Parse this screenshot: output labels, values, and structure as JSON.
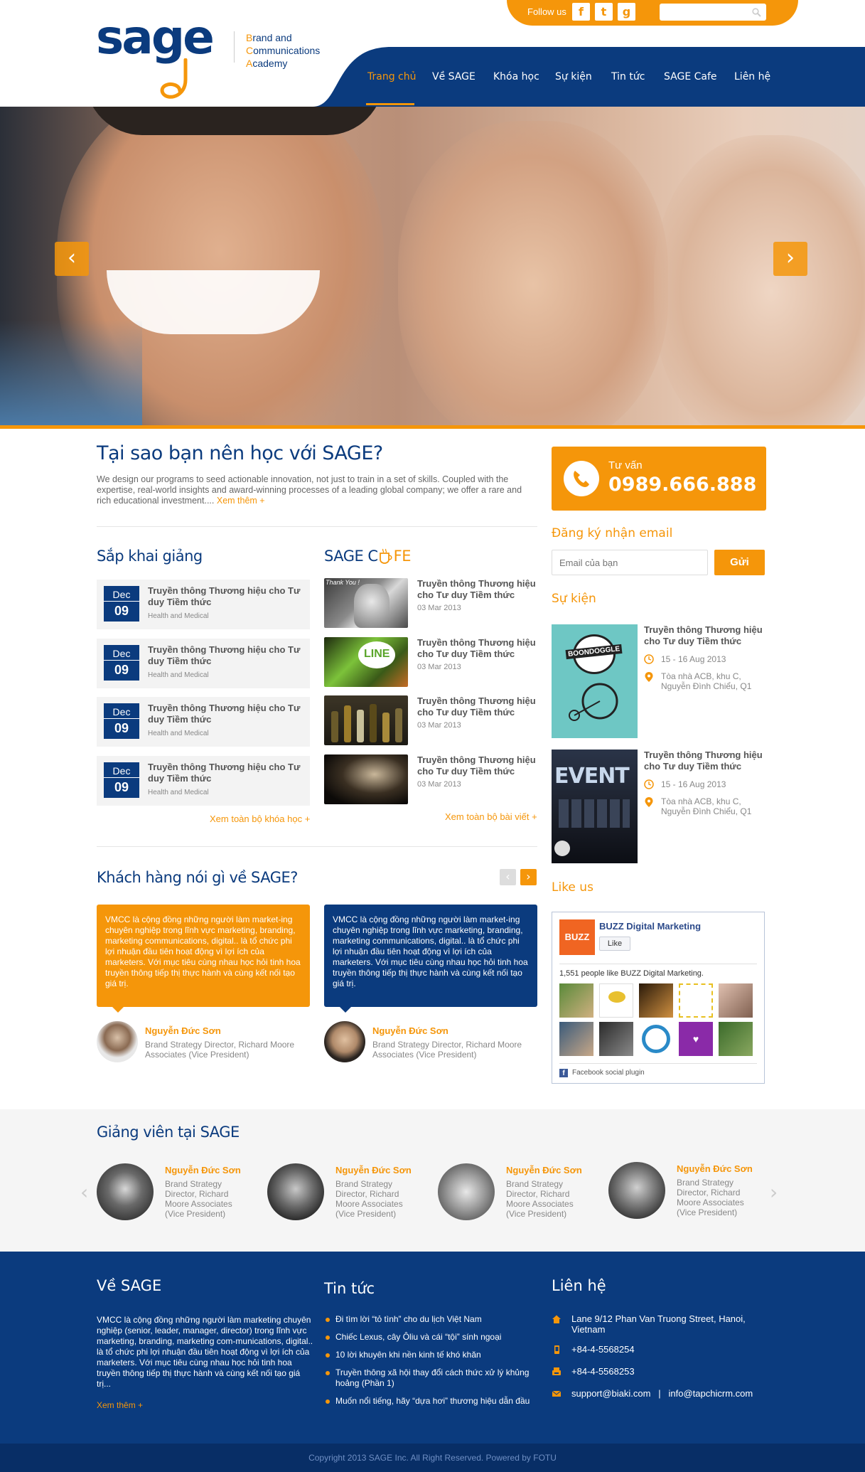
{
  "header": {
    "follow_label": "Follow us",
    "social": [
      {
        "name": "facebook-icon",
        "glyph": "f"
      },
      {
        "name": "twitter-icon",
        "glyph": "t"
      },
      {
        "name": "google-plus-icon",
        "glyph": "g"
      }
    ],
    "logo_text": "sage",
    "tagline": [
      "Brand and",
      "Communications",
      "Academy"
    ],
    "nav": [
      "Trang chủ",
      "Về SAGE",
      "Khóa học",
      "Sự kiện",
      "Tin tức",
      "SAGE Cafe",
      "Liên hệ"
    ]
  },
  "hero": {
    "prev": "‹",
    "next": "›"
  },
  "why": {
    "title": "Tại sao bạn nên học với SAGE?",
    "text": "We design our programs to seed actionable innovation, not just to train in a set of skills. Coupled with the expertise, real-world insights and award-winning processes of a leading global company; we offer a rare and rich educational investment....",
    "more": "Xem thêm +"
  },
  "upcoming": {
    "title": "Sắp khai giảng",
    "items": [
      {
        "month": "Dec",
        "day": "09",
        "title": "Truyền thông Thương hiệu cho Tư duy Tiềm thức",
        "cat": "Health and Medical"
      },
      {
        "month": "Dec",
        "day": "09",
        "title": "Truyền thông Thương hiệu cho Tư duy Tiềm thức",
        "cat": "Health and Medical"
      },
      {
        "month": "Dec",
        "day": "09",
        "title": "Truyền thông Thương hiệu cho Tư duy Tiềm thức",
        "cat": "Health and Medical"
      },
      {
        "month": "Dec",
        "day": "09",
        "title": "Truyền thông Thương hiệu cho Tư duy Tiềm thức",
        "cat": "Health and Medical"
      }
    ],
    "more": "Xem toàn bộ khóa học +"
  },
  "cafe": {
    "title_a": "SAGE C",
    "title_b": "FE",
    "items": [
      {
        "title": "Truyền thông Thương hiệu cho Tư duy Tiềm thức",
        "date": "03 Mar 2013"
      },
      {
        "title": "Truyền thông Thương hiệu cho Tư duy Tiềm thức",
        "date": "03 Mar 2013"
      },
      {
        "title": "Truyền thông Thương hiệu cho Tư duy Tiềm thức",
        "date": "03 Mar 2013"
      },
      {
        "title": "Truyền thông Thương hiệu cho Tư duy Tiềm thức",
        "date": "03 Mar 2013"
      }
    ],
    "thumb1_text": "Thank You !",
    "thumb2_text": "LINE",
    "more": "Xem toàn bộ bài viết +"
  },
  "testimonials": {
    "title": "Khách hàng nói gì về SAGE?",
    "items": [
      {
        "text": "VMCC là cộng đồng những người làm market-ing chuyên nghiệp trong lĩnh vực marketing, branding, marketing communications, digital.. là tổ chức phi lợi nhuận đầu tiên hoạt động vì lợi ích của marketers. Với mục tiêu cùng nhau học hỏi tinh hoa truyền thông tiếp thị thực hành và cùng kết nối tạo giá trị.",
        "name": "Nguyễn Đức Sơn",
        "role": "Brand Strategy Director, Richard Moore Associates (Vice President)"
      },
      {
        "text": "VMCC là cộng đồng những người làm market-ing chuyên nghiệp trong lĩnh vực marketing, branding, marketing communications, digital.. là tổ chức phi lợi nhuận đầu tiên hoạt động vì lợi ích của marketers. Với mục tiêu cùng nhau học hỏi tinh hoa truyền thông tiếp thị thực hành và cùng kết nối tạo giá trị.",
        "name": "Nguyễn Đức Sơn",
        "role": "Brand Strategy Director, Richard Moore Associates (Vice President)"
      }
    ]
  },
  "sidebar": {
    "hotline_label": "Tư vấn",
    "hotline": "0989.666.888",
    "email_title": "Đăng ký nhận email",
    "email_placeholder": "Email của bạn",
    "email_button": "Gửi",
    "events_title": "Sự kiện",
    "events": [
      {
        "title": "Truyền thông Thương hiệu cho Tư duy Tiềm thức",
        "date": "15 - 16 Aug 2013",
        "place": "Tòa nhà ACB, khu C, Nguyễn Đình Chiểu, Q1",
        "poster": "BOONDOGGLE"
      },
      {
        "title": "Truyền thông Thương hiệu cho Tư duy Tiềm thức",
        "date": "15 - 16 Aug 2013",
        "place": "Tòa nhà ACB, khu C, Nguyễn Đình Chiểu, Q1",
        "poster": "EVENT"
      }
    ],
    "like_title": "Like us",
    "fb": {
      "page": "BUZZ Digital Marketing",
      "like": "Like",
      "count": "1,551 people like BUZZ Digital Marketing.",
      "plugin": "Facebook social plugin",
      "logo": "BUZZ"
    }
  },
  "lecturers": {
    "title": "Giảng viên tại SAGE",
    "items": [
      {
        "name": "Nguyễn Đức Sơn",
        "role": "Brand Strategy Director, Richard Moore Associates (Vice President)"
      },
      {
        "name": "Nguyễn Đức Sơn",
        "role": "Brand Strategy Director, Richard Moore Associates (Vice President)"
      },
      {
        "name": "Nguyễn Đức Sơn",
        "role": "Brand Strategy Director, Richard Moore Associates (Vice President)"
      },
      {
        "name": "Nguyễn Đức Sơn",
        "role": "Brand Strategy Director, Richard Moore Associates (Vice President)"
      }
    ]
  },
  "footer": {
    "about_title": "Về SAGE",
    "about_text": "VMCC là cộng đồng những người làm marketing chuyên nghiệp (senior, leader, manager, director) trong lĩnh vực marketing, branding, marketing com-munications, digital.. là tổ chức phi lợi nhuận đầu tiên hoạt động vì lợi ích của marketers. Với mục tiêu cùng nhau học hỏi tinh hoa truyền thông tiếp thị thực hành và cùng kết nối tạo giá trị...",
    "about_more": "Xem thêm +",
    "news_title": "Tin tức",
    "news": [
      "Đi tìm lời “tỏ tình” cho du lịch Việt Nam",
      "Chiếc Lexus, cây Ôliu và cái “tội” sính ngoại",
      "10 lời khuyên khi nền kinh tế khó khăn",
      "Truyền thông xã hội thay đổi cách thức xử lý khủng hoảng (Phần 1)",
      "Muốn nổi tiếng, hãy “dựa hơi” thương hiệu dẫn đầu"
    ],
    "contact_title": "Liên hệ",
    "address": "Lane 9/12 Phan Van Truong Street, Hanoi, Vietnam",
    "phone": "+84-4-5568254",
    "fax": "+84-4-5568253",
    "email": "support@biaki.com   |   info@tapchicrm.com",
    "copyright": "Copyright 2013 SAGE Inc. All Right Reserved. Powered by FOTU"
  },
  "colors": {
    "brand_blue": "#0b3b7e",
    "brand_orange": "#f5960a"
  }
}
